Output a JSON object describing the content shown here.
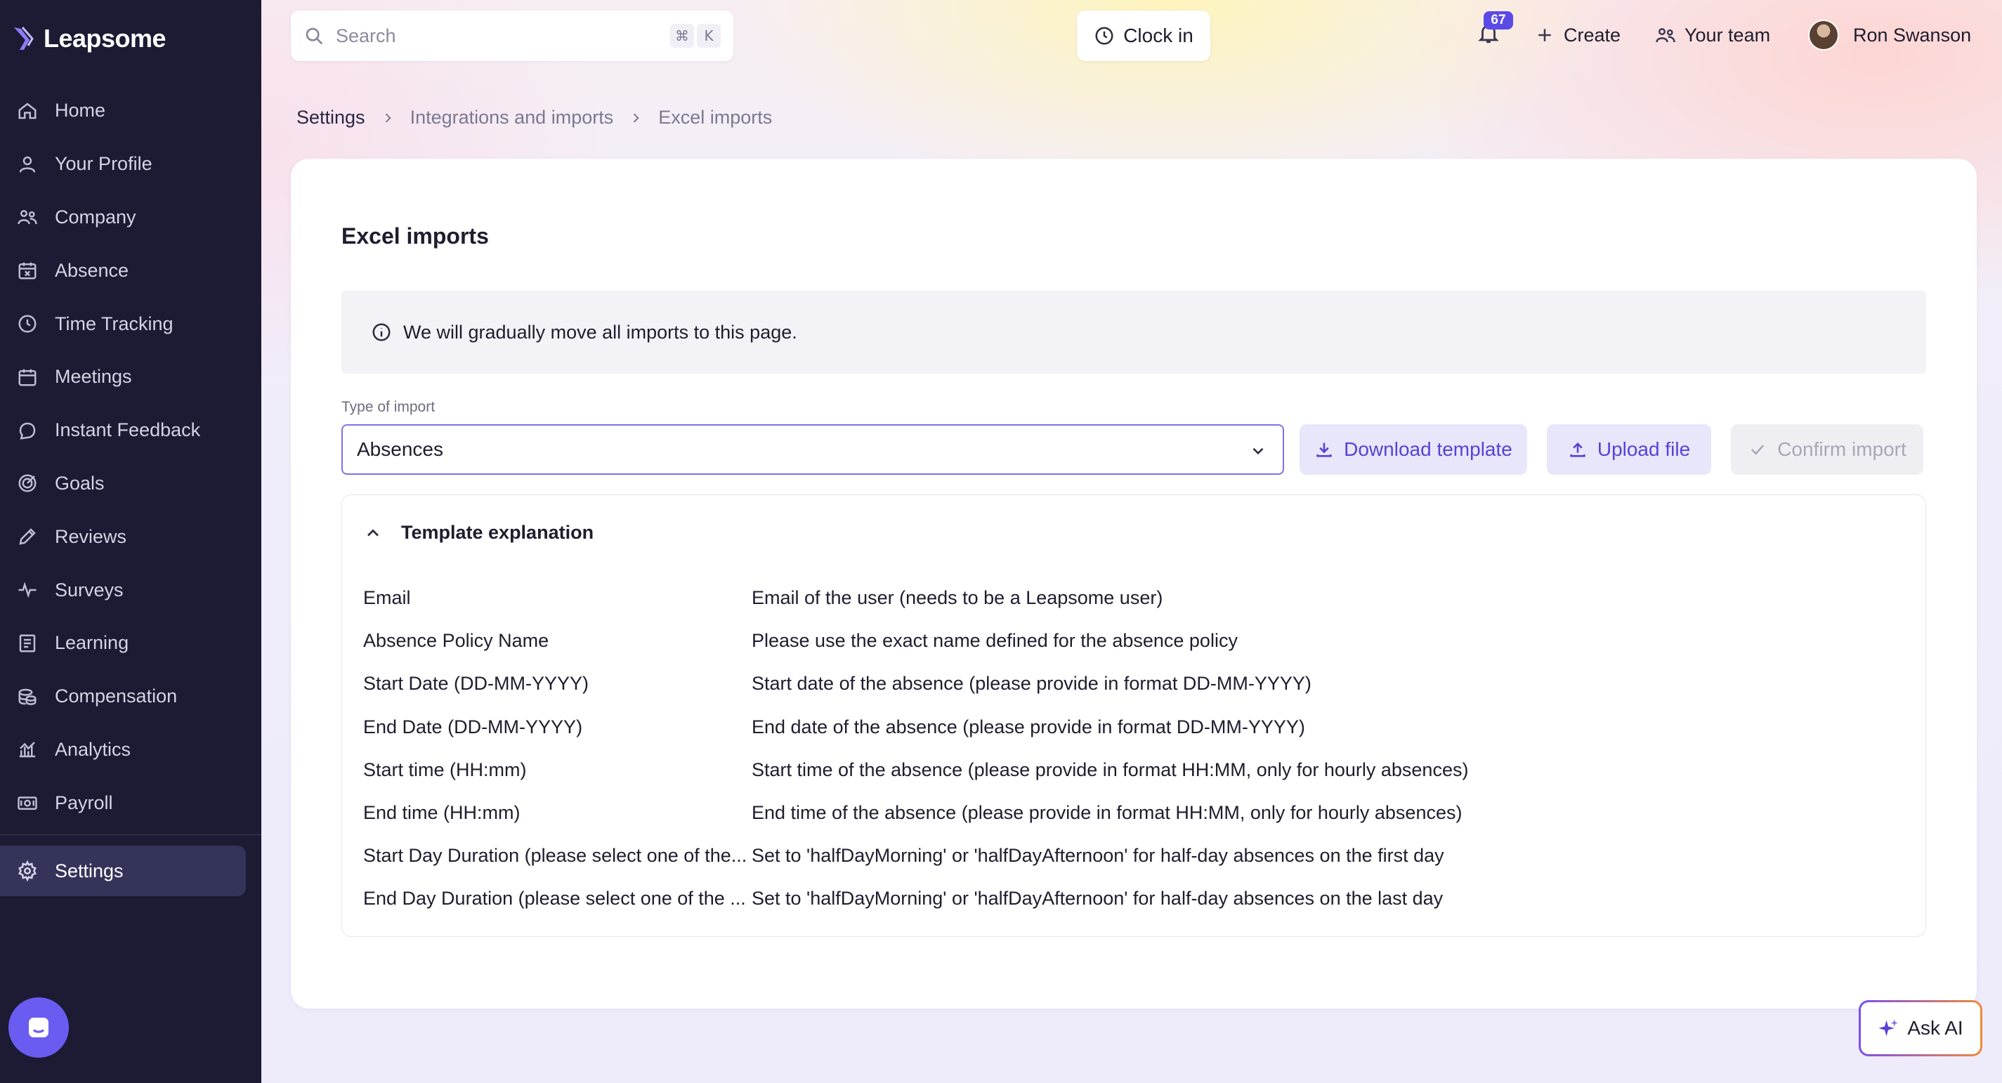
{
  "app": {
    "brand": "Leapsome"
  },
  "sidebar": {
    "items": [
      {
        "label": "Home",
        "icon": "home-icon"
      },
      {
        "label": "Your Profile",
        "icon": "user-icon"
      },
      {
        "label": "Company",
        "icon": "company-icon"
      },
      {
        "label": "Absence",
        "icon": "calendar-x-icon"
      },
      {
        "label": "Time Tracking",
        "icon": "clock-icon"
      },
      {
        "label": "Meetings",
        "icon": "calendar-icon"
      },
      {
        "label": "Instant Feedback",
        "icon": "chat-icon"
      },
      {
        "label": "Goals",
        "icon": "target-icon"
      },
      {
        "label": "Reviews",
        "icon": "pencil-icon"
      },
      {
        "label": "Surveys",
        "icon": "pulse-icon"
      },
      {
        "label": "Learning",
        "icon": "book-icon"
      },
      {
        "label": "Compensation",
        "icon": "coins-icon"
      },
      {
        "label": "Analytics",
        "icon": "chart-icon"
      },
      {
        "label": "Payroll",
        "icon": "money-icon"
      }
    ],
    "settings_label": "Settings"
  },
  "topbar": {
    "search_placeholder": "Search",
    "shortcut_cmd": "⌘",
    "shortcut_key": "K",
    "clock_in_label": "Clock in",
    "notification_count": "67",
    "create_label": "Create",
    "team_label": "Your team",
    "user_name": "Ron Swanson"
  },
  "breadcrumb": {
    "items": [
      "Settings",
      "Integrations and imports",
      "Excel imports"
    ]
  },
  "page": {
    "title": "Excel imports",
    "info_text": "We will gradually move all imports to this page.",
    "type_label": "Type of import",
    "type_value": "Absences",
    "download_label": "Download template",
    "upload_label": "Upload file",
    "confirm_label": "Confirm import",
    "explanation_title": "Template explanation",
    "rows": [
      {
        "k": "Email",
        "v": "Email of the user (needs to be a Leapsome user)"
      },
      {
        "k": "Absence Policy Name",
        "v": "Please use the exact name defined for the absence policy"
      },
      {
        "k": "Start Date (DD-MM-YYYY)",
        "v": "Start date of the absence (please provide in format DD-MM-YYYY)"
      },
      {
        "k": "End Date (DD-MM-YYYY)",
        "v": "End date of the absence (please provide in format DD-MM-YYYY)"
      },
      {
        "k": "Start time (HH:mm)",
        "v": "Start time of the absence (please provide in format HH:MM, only for hourly absences)"
      },
      {
        "k": "End time (HH:mm)",
        "v": "End time of the absence (please provide in format HH:MM, only for hourly absences)"
      },
      {
        "k": "Start Day Duration (please select one of the...",
        "v": "Set to 'halfDayMorning' or 'halfDayAfternoon' for half-day absences on the first day"
      },
      {
        "k": "End Day Duration (please select one of the ...",
        "v": "Set to 'halfDayMorning' or 'halfDayAfternoon' for half-day absences on the last day"
      }
    ]
  },
  "ask_ai_label": "Ask AI",
  "colors": {
    "sidebar_bg": "#1c1b33",
    "accent": "#5444d6",
    "badge": "#5b4ae6"
  }
}
